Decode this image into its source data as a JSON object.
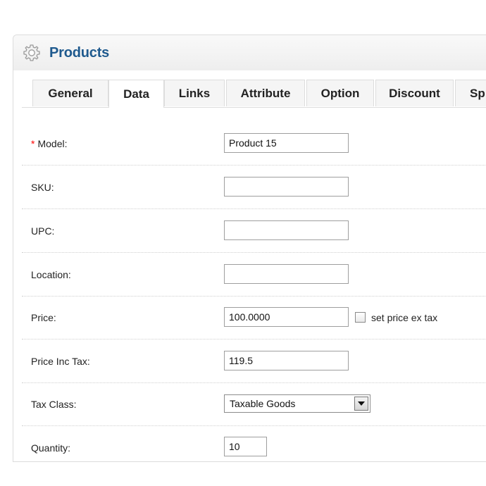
{
  "header": {
    "title": "Products",
    "icon": "gear-icon"
  },
  "tabs": [
    {
      "label": "General",
      "active": false
    },
    {
      "label": "Data",
      "active": true
    },
    {
      "label": "Links",
      "active": false
    },
    {
      "label": "Attribute",
      "active": false
    },
    {
      "label": "Option",
      "active": false
    },
    {
      "label": "Discount",
      "active": false
    },
    {
      "label": "Sp",
      "active": false
    }
  ],
  "form": {
    "model": {
      "label": "Model:",
      "required_mark": "*",
      "value": "Product 15"
    },
    "sku": {
      "label": "SKU:",
      "value": ""
    },
    "upc": {
      "label": "UPC:",
      "value": ""
    },
    "location": {
      "label": "Location:",
      "value": ""
    },
    "price": {
      "label": "Price:",
      "value": "100.0000",
      "checkbox_label": "set price ex tax",
      "checked": false
    },
    "price_inc_tax": {
      "label": "Price Inc Tax:",
      "value": "119.5"
    },
    "tax_class": {
      "label": "Tax Class:",
      "selected": "Taxable Goods"
    },
    "quantity": {
      "label": "Quantity:",
      "value": "10"
    }
  },
  "colors": {
    "title": "#1f5a8e",
    "required": "#ff0000"
  }
}
